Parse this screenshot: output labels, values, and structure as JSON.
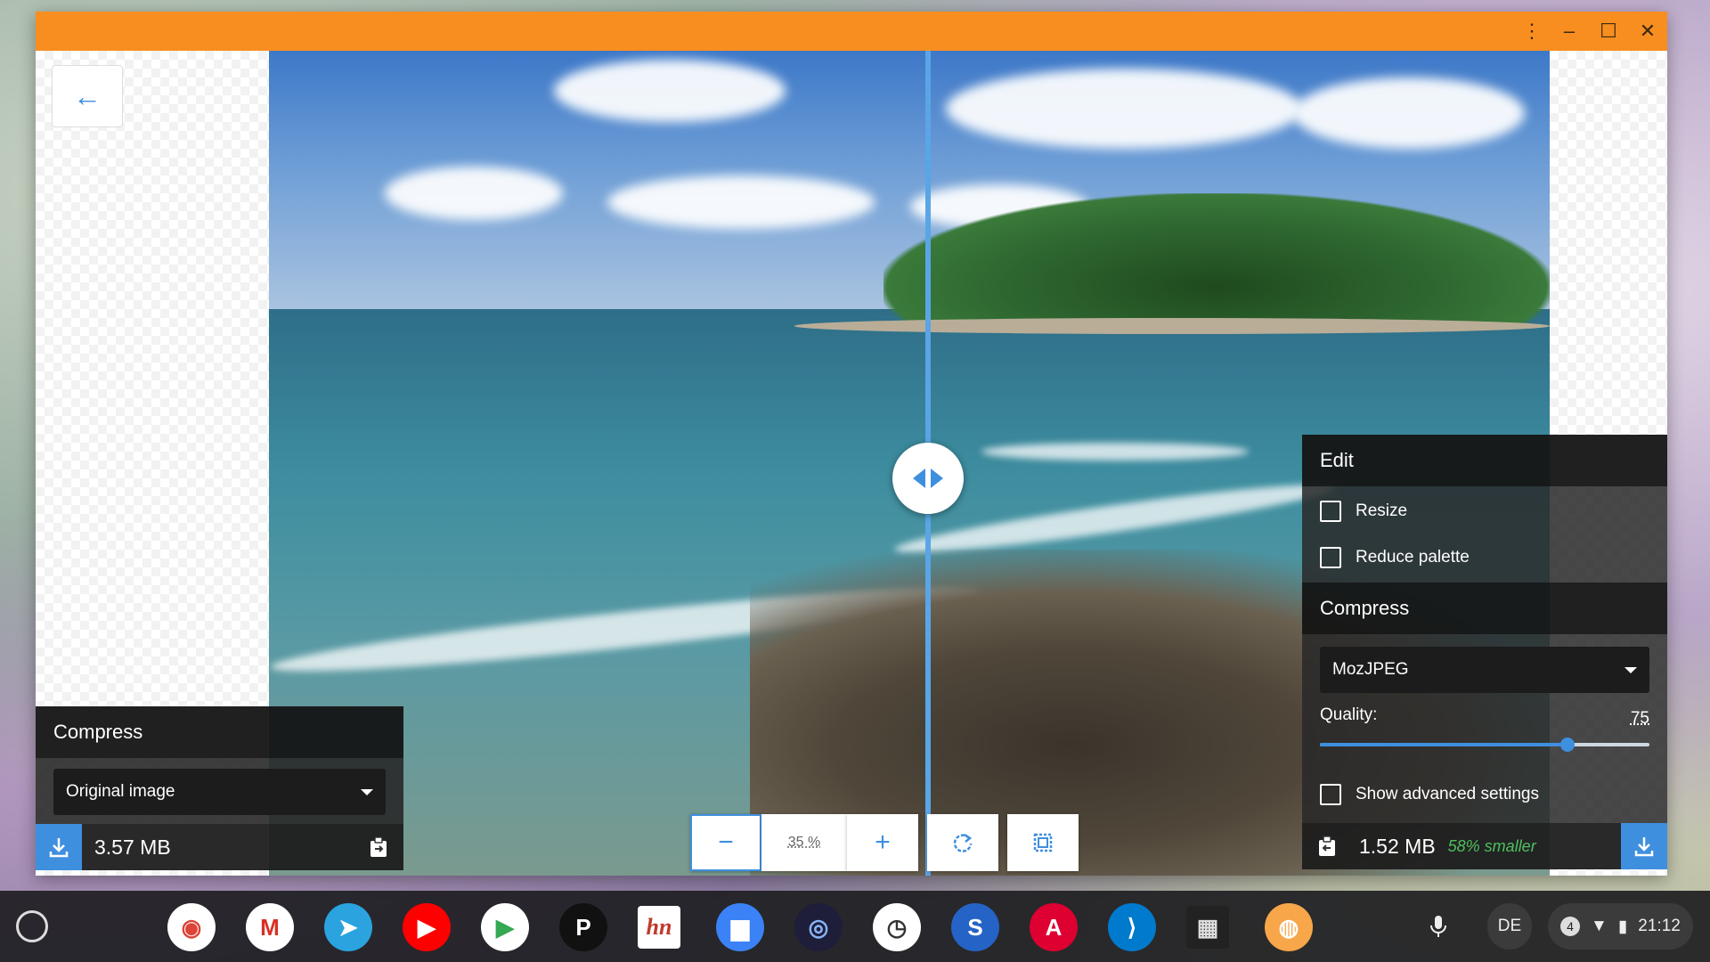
{
  "window": {
    "titlebar_color": "#f88e20",
    "menu_icon": "more-vert-icon",
    "minimize_icon": "minimize-icon",
    "maximize_icon": "maximize-icon",
    "close_icon": "close-icon"
  },
  "back_button": {
    "icon": "arrow-left-icon"
  },
  "left_panel": {
    "title": "Compress",
    "select_value": "Original image",
    "size": "3.57 MB"
  },
  "right_panel": {
    "edit_title": "Edit",
    "resize_label": "Resize",
    "reduce_palette_label": "Reduce palette",
    "compress_title": "Compress",
    "select_value": "MozJPEG",
    "quality_label": "Quality:",
    "quality_value": "75",
    "quality_fraction": 0.75,
    "advanced_label": "Show advanced settings",
    "size": "1.52 MB",
    "savings": "58% smaller"
  },
  "zoom": {
    "minus_label": "−",
    "value": "35 %",
    "plus_label": "+",
    "rotate_icon": "rotate-icon",
    "background_toggle_icon": "background-toggle-icon"
  },
  "colors": {
    "accent": "#3f8fdf",
    "savings": "#4fbf5f"
  },
  "shelf": {
    "apps": [
      "Chrome",
      "Gmail",
      "Telegram",
      "YouTube",
      "Play Store",
      "Pocket Casts",
      "Hacker News",
      "Files",
      "Chromium",
      "Clock",
      "Simplenote",
      "Angular",
      "VS Code",
      "Terminal",
      "Squoosh"
    ],
    "lang": "DE",
    "notifications": "4",
    "time": "21:12"
  }
}
